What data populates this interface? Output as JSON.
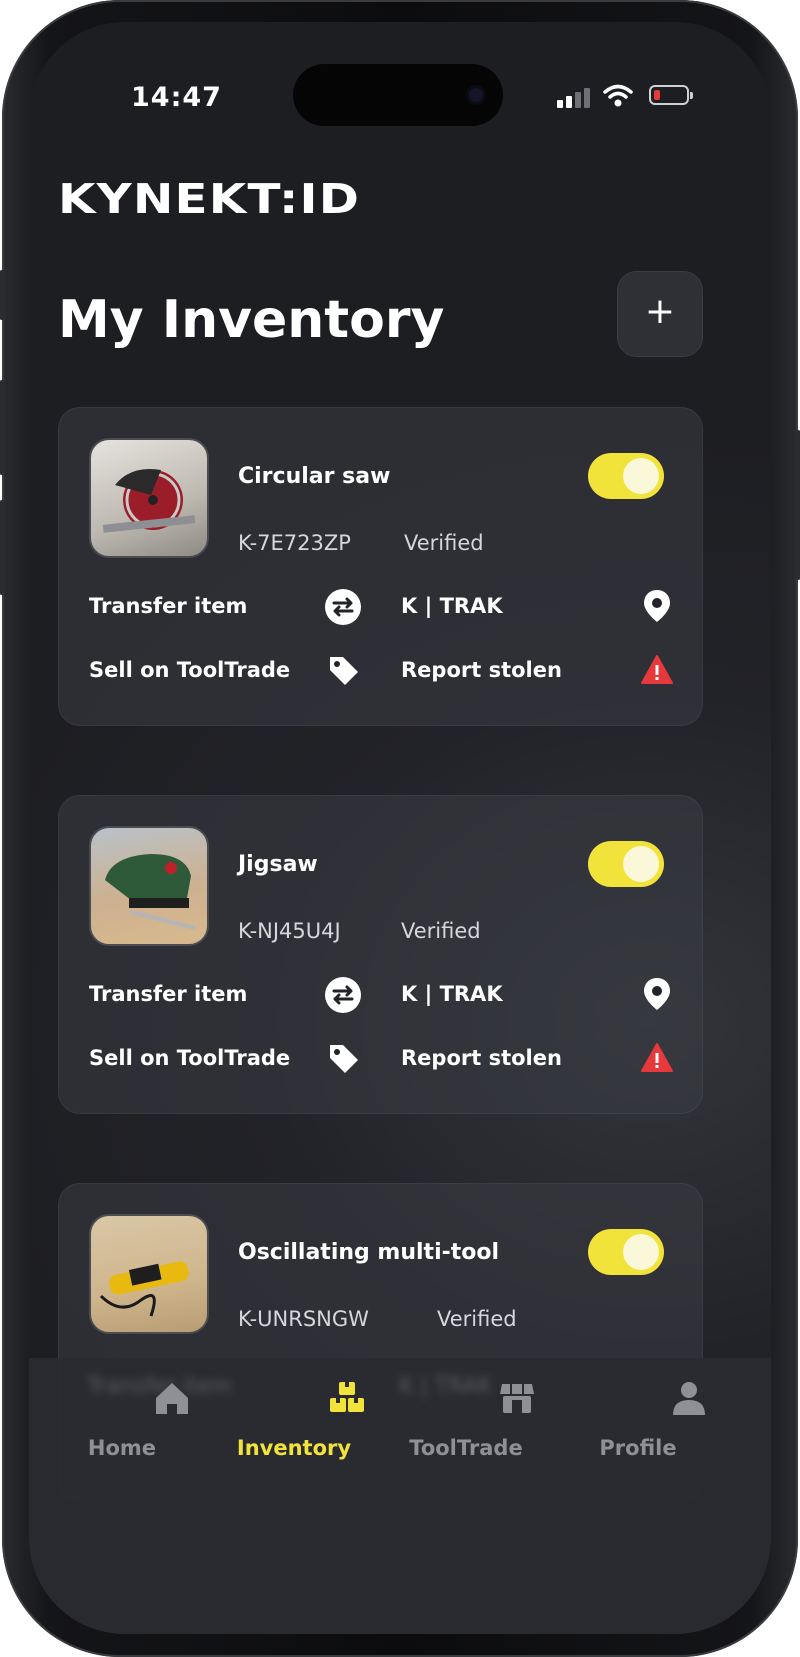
{
  "status_bar": {
    "time": "14:47"
  },
  "app": {
    "logo": "KYNEKT:ID"
  },
  "page": {
    "title": "My Inventory",
    "add_label": "+"
  },
  "items": [
    {
      "name": "Circular saw",
      "id": "K-7E723ZP",
      "status": "Verified",
      "enabled": true,
      "thumbnail": "circular-saw-photo"
    },
    {
      "name": "Jigsaw",
      "id": "K-NJ45U4J",
      "status": "Verified",
      "enabled": true,
      "thumbnail": "jigsaw-photo"
    },
    {
      "name": "Oscillating multi-tool",
      "id": "K-UNRSNGW",
      "status": "Verified",
      "enabled": true,
      "thumbnail": "multi-tool-photo"
    }
  ],
  "actions": {
    "transfer": "Transfer item",
    "track": "K | TRAK",
    "sell": "Sell on ToolTrade",
    "report": "Report stolen"
  },
  "nav": {
    "home": "Home",
    "inventory": "Inventory",
    "tooltrade": "ToolTrade",
    "profile": "Profile",
    "active": "inventory"
  },
  "colors": {
    "accent": "#f2e33a",
    "danger": "#e5393b",
    "background": "#222328"
  }
}
